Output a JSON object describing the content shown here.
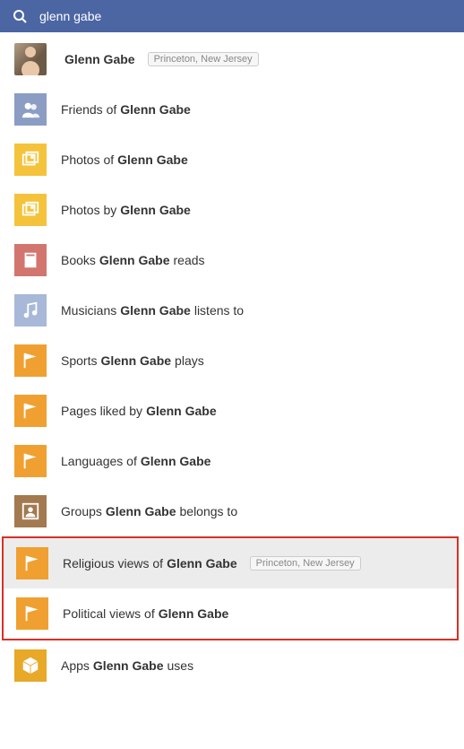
{
  "search": {
    "value": "glenn gabe"
  },
  "badge": "Princeton, New Jersey",
  "items": [
    {
      "icon": "avatar",
      "bg": "",
      "text_before": "",
      "bold": "Glenn Gabe",
      "text_after": "",
      "badge": true,
      "hl": false
    },
    {
      "icon": "friends",
      "bg": "bg-blue",
      "text_before": "Friends of ",
      "bold": "Glenn Gabe",
      "text_after": "",
      "badge": false,
      "hl": false
    },
    {
      "icon": "photos",
      "bg": "bg-yellow",
      "text_before": "Photos of ",
      "bold": "Glenn Gabe",
      "text_after": "",
      "badge": false,
      "hl": false
    },
    {
      "icon": "photos",
      "bg": "bg-yellow",
      "text_before": "Photos by ",
      "bold": "Glenn Gabe",
      "text_after": "",
      "badge": false,
      "hl": false
    },
    {
      "icon": "book",
      "bg": "bg-red",
      "text_before": "Books ",
      "bold": "Glenn Gabe",
      "text_after": " reads",
      "badge": false,
      "hl": false
    },
    {
      "icon": "music",
      "bg": "bg-ltblue",
      "text_before": "Musicians ",
      "bold": "Glenn Gabe",
      "text_after": " listens to",
      "badge": false,
      "hl": false
    },
    {
      "icon": "flag",
      "bg": "bg-orange",
      "text_before": "Sports ",
      "bold": "Glenn Gabe",
      "text_after": " plays",
      "badge": false,
      "hl": false
    },
    {
      "icon": "flag",
      "bg": "bg-orange",
      "text_before": "Pages liked by ",
      "bold": "Glenn Gabe",
      "text_after": "",
      "badge": false,
      "hl": false
    },
    {
      "icon": "flag",
      "bg": "bg-orange",
      "text_before": "Languages of ",
      "bold": "Glenn Gabe",
      "text_after": "",
      "badge": false,
      "hl": false
    },
    {
      "icon": "group",
      "bg": "bg-brown",
      "text_before": "Groups ",
      "bold": "Glenn Gabe",
      "text_after": " belongs to",
      "badge": false,
      "hl": false
    },
    {
      "icon": "flag",
      "bg": "bg-orange",
      "text_before": "Religious views of ",
      "bold": "Glenn Gabe",
      "text_after": "",
      "badge": true,
      "hl": true,
      "boxed": true
    },
    {
      "icon": "flag",
      "bg": "bg-orange",
      "text_before": "Political views of ",
      "bold": "Glenn Gabe",
      "text_after": "",
      "badge": false,
      "hl": false,
      "boxed": true
    },
    {
      "icon": "cube",
      "bg": "bg-gold",
      "text_before": "Apps ",
      "bold": "Glenn Gabe",
      "text_after": " uses",
      "badge": false,
      "hl": false
    }
  ]
}
